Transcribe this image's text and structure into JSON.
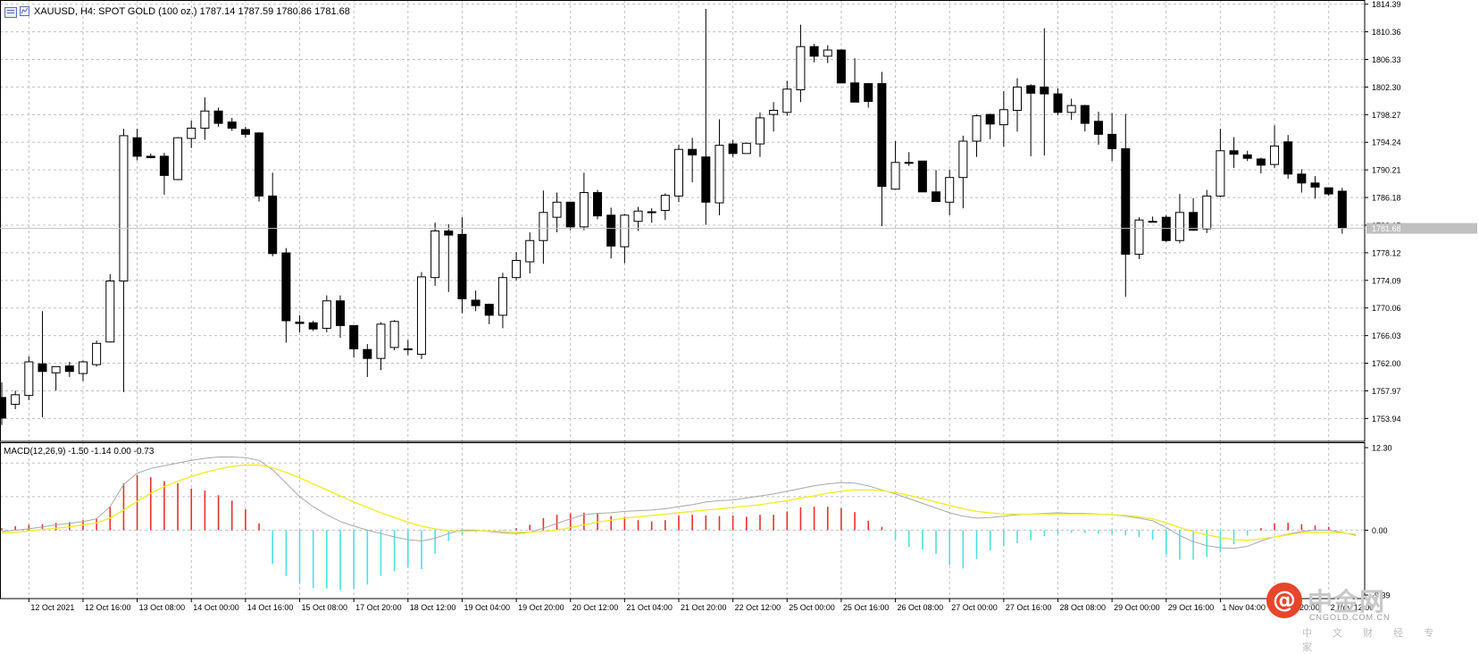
{
  "header": {
    "symbol_line": "XAUUSD, H4:  SPOT GOLD (100 oz.)  1787.14 1787.59 1780.86 1781.68",
    "macd_line": "MACD(12,26,9) -1.50 -1.14 0.00 -0.73"
  },
  "watermark": {
    "brand": "中金网",
    "site": "CNGOLD.COM.CN",
    "tagline": "中 文 财 经 专 家"
  },
  "colors": {
    "bull_body": "#ffffff",
    "bear_body": "#000000",
    "grid": "#c0c0c0",
    "macd_pos": "#e8312f",
    "macd_neg": "#4ee0e0",
    "macd_line": "#a8a8a8",
    "signal_line": "#f2ec2e",
    "current_price_bg": "#c0c0c0"
  },
  "chart_data": {
    "type": "candlestick",
    "price_axis": {
      "ylim": [
        1750.6,
        1815.0
      ],
      "ticks": [
        "1814.39",
        "1810.36",
        "1806.33",
        "1802.30",
        "1798.27",
        "1794.24",
        "1790.21",
        "1786.18",
        "1782.15",
        "1778.12",
        "1774.09",
        "1770.06",
        "1766.03",
        "1762.00",
        "1757.97",
        "1753.94"
      ],
      "tick_values": [
        1814.39,
        1810.36,
        1806.33,
        1802.3,
        1798.27,
        1794.24,
        1790.21,
        1786.18,
        1782.15,
        1778.12,
        1774.09,
        1770.06,
        1766.03,
        1762.0,
        1757.97,
        1753.94
      ],
      "current_price": 1781.68,
      "current_price_label": "1781.68"
    },
    "time_axis": {
      "labels": [
        "12 Oct 2021",
        "12 Oct 16:00",
        "13 Oct 08:00",
        "14 Oct 00:00",
        "14 Oct 16:00",
        "15 Oct 08:00",
        "17 Oct 20:00",
        "18 Oct 12:00",
        "19 Oct 04:00",
        "19 Oct 20:00",
        "20 Oct 12:00",
        "21 Oct 04:00",
        "21 Oct 20:00",
        "22 Oct 12:00",
        "25 Oct 00:00",
        "25 Oct 16:00",
        "26 Oct 08:00",
        "27 Oct 00:00",
        "27 Oct 16:00",
        "28 Oct 08:00",
        "29 Oct 00:00",
        "29 Oct 16:00",
        "1 Nov 04:00",
        "1 Nov 20:00",
        "2 Nov 12:00"
      ],
      "label_bar_index": [
        2,
        6,
        10,
        14,
        18,
        22,
        26,
        30,
        34,
        38,
        42,
        46,
        50,
        54,
        58,
        62,
        66,
        70,
        74,
        78,
        82,
        86,
        90,
        94,
        98
      ]
    },
    "ohlc": [
      [
        1757.0,
        1759.2,
        1753.0,
        1754.0
      ],
      [
        1756.0,
        1758.0,
        1755.3,
        1757.4
      ],
      [
        1757.3,
        1763.0,
        1756.6,
        1762.2
      ],
      [
        1761.9,
        1769.6,
        1754.1,
        1760.8
      ],
      [
        1760.6,
        1761.5,
        1758.0,
        1761.5
      ],
      [
        1761.6,
        1762.2,
        1760.0,
        1760.8
      ],
      [
        1760.5,
        1762.4,
        1759.4,
        1762.2
      ],
      [
        1761.8,
        1765.3,
        1761.5,
        1764.9
      ],
      [
        1765.1,
        1775.0,
        1765.0,
        1774.0
      ],
      [
        1774.0,
        1796.2,
        1757.8,
        1795.2
      ],
      [
        1794.9,
        1796.2,
        1791.6,
        1792.2
      ],
      [
        1792.2,
        1792.6,
        1791.9,
        1792.0
      ],
      [
        1792.2,
        1792.7,
        1786.6,
        1789.4
      ],
      [
        1788.8,
        1795.0,
        1788.7,
        1794.9
      ],
      [
        1794.8,
        1797.4,
        1793.4,
        1796.3
      ],
      [
        1796.3,
        1800.8,
        1794.6,
        1798.8
      ],
      [
        1798.8,
        1799.3,
        1796.5,
        1797.0
      ],
      [
        1797.2,
        1797.8,
        1795.9,
        1796.3
      ],
      [
        1796.1,
        1796.5,
        1794.9,
        1795.4
      ],
      [
        1795.6,
        1795.7,
        1785.6,
        1786.4
      ],
      [
        1786.4,
        1789.8,
        1777.6,
        1778.0
      ],
      [
        1778.1,
        1778.8,
        1765.0,
        1768.2
      ],
      [
        1768.0,
        1769.0,
        1766.5,
        1767.8
      ],
      [
        1767.9,
        1768.2,
        1766.7,
        1767.0
      ],
      [
        1767.1,
        1771.9,
        1766.5,
        1771.1
      ],
      [
        1771.1,
        1771.9,
        1765.7,
        1767.5
      ],
      [
        1767.5,
        1767.5,
        1762.8,
        1764.1
      ],
      [
        1764.0,
        1764.8,
        1760.0,
        1762.7
      ],
      [
        1762.7,
        1768.0,
        1761.0,
        1767.7
      ],
      [
        1764.3,
        1768.3,
        1763.9,
        1768.1
      ],
      [
        1764.0,
        1765.4,
        1763.2,
        1764.1
      ],
      [
        1763.3,
        1775.3,
        1762.6,
        1774.6
      ],
      [
        1774.5,
        1782.5,
        1773.3,
        1781.3
      ],
      [
        1781.3,
        1782.3,
        1772.4,
        1780.7
      ],
      [
        1780.8,
        1783.3,
        1769.3,
        1771.4
      ],
      [
        1771.2,
        1772.6,
        1769.6,
        1770.4
      ],
      [
        1770.6,
        1770.7,
        1767.7,
        1769.0
      ],
      [
        1769.0,
        1775.2,
        1767.1,
        1774.5
      ],
      [
        1774.5,
        1778.2,
        1774.1,
        1777.0
      ],
      [
        1776.8,
        1781.1,
        1775.1,
        1779.9
      ],
      [
        1779.9,
        1787.2,
        1776.5,
        1784.0
      ],
      [
        1783.3,
        1786.9,
        1781.1,
        1785.5
      ],
      [
        1785.5,
        1785.5,
        1781.4,
        1781.9
      ],
      [
        1781.9,
        1789.8,
        1781.4,
        1786.9
      ],
      [
        1786.9,
        1787.3,
        1783.0,
        1783.5
      ],
      [
        1783.6,
        1784.7,
        1777.3,
        1779.1
      ],
      [
        1779.0,
        1783.8,
        1776.6,
        1783.6
      ],
      [
        1782.7,
        1784.8,
        1781.3,
        1784.2
      ],
      [
        1784.1,
        1784.6,
        1782.5,
        1784.0
      ],
      [
        1784.3,
        1786.8,
        1782.9,
        1786.5
      ],
      [
        1786.4,
        1793.9,
        1785.5,
        1793.2
      ],
      [
        1793.2,
        1794.9,
        1788.4,
        1792.4
      ],
      [
        1792.1,
        1813.7,
        1782.2,
        1785.5
      ],
      [
        1785.4,
        1797.6,
        1783.6,
        1793.8
      ],
      [
        1794.0,
        1794.6,
        1792.1,
        1792.6
      ],
      [
        1792.6,
        1794.1,
        1792.6,
        1794.1
      ],
      [
        1794.0,
        1798.6,
        1792.1,
        1797.8
      ],
      [
        1798.3,
        1800.1,
        1795.8,
        1798.9
      ],
      [
        1798.6,
        1803.2,
        1798.1,
        1802.0
      ],
      [
        1801.9,
        1811.4,
        1800.1,
        1808.2
      ],
      [
        1808.2,
        1808.6,
        1805.9,
        1806.8
      ],
      [
        1806.8,
        1808.4,
        1805.8,
        1807.7
      ],
      [
        1807.7,
        1807.8,
        1802.9,
        1802.9
      ],
      [
        1802.9,
        1806.5,
        1800.6,
        1800.1
      ],
      [
        1802.8,
        1802.9,
        1799.3,
        1800.2
      ],
      [
        1802.8,
        1804.5,
        1782.0,
        1787.8
      ],
      [
        1787.4,
        1794.4,
        1787.3,
        1791.3
      ],
      [
        1791.3,
        1792.8,
        1790.8,
        1791.2
      ],
      [
        1791.5,
        1791.5,
        1787.3,
        1787.0
      ],
      [
        1787.0,
        1790.2,
        1786.2,
        1785.6
      ],
      [
        1785.5,
        1790.2,
        1783.6,
        1789.1
      ],
      [
        1789.1,
        1795.2,
        1784.6,
        1794.4
      ],
      [
        1794.4,
        1798.3,
        1792.1,
        1798.1
      ],
      [
        1798.3,
        1798.4,
        1794.7,
        1796.9
      ],
      [
        1796.8,
        1801.7,
        1793.6,
        1799.0
      ],
      [
        1798.9,
        1803.6,
        1795.8,
        1802.3
      ],
      [
        1802.5,
        1802.7,
        1792.2,
        1801.4
      ],
      [
        1802.3,
        1810.9,
        1792.3,
        1801.3
      ],
      [
        1801.3,
        1802.1,
        1798.2,
        1798.6
      ],
      [
        1798.6,
        1800.6,
        1797.5,
        1799.6
      ],
      [
        1799.6,
        1799.7,
        1795.8,
        1797.0
      ],
      [
        1797.3,
        1798.7,
        1793.9,
        1795.4
      ],
      [
        1795.4,
        1798.5,
        1791.5,
        1793.3
      ],
      [
        1793.3,
        1798.4,
        1771.7,
        1777.9
      ],
      [
        1777.9,
        1783.3,
        1777.2,
        1782.9
      ],
      [
        1782.7,
        1783.4,
        1782.6,
        1782.7
      ],
      [
        1783.3,
        1783.6,
        1779.7,
        1779.9
      ],
      [
        1779.9,
        1786.7,
        1779.5,
        1784.0
      ],
      [
        1784.0,
        1786.1,
        1781.4,
        1781.4
      ],
      [
        1781.6,
        1787.3,
        1781.0,
        1786.4
      ],
      [
        1786.4,
        1796.2,
        1786.2,
        1793.0
      ],
      [
        1793.0,
        1795.0,
        1790.5,
        1792.5
      ],
      [
        1792.4,
        1793.0,
        1791.5,
        1791.9
      ],
      [
        1791.8,
        1792.0,
        1789.7,
        1790.9
      ],
      [
        1791.0,
        1796.7,
        1790.5,
        1793.7
      ],
      [
        1794.3,
        1795.3,
        1788.9,
        1789.6
      ],
      [
        1789.6,
        1790.3,
        1786.9,
        1788.3
      ],
      [
        1788.3,
        1789.3,
        1786.0,
        1787.7
      ],
      [
        1787.6,
        1787.6,
        1786.4,
        1786.7
      ],
      [
        1787.1,
        1787.6,
        1780.9,
        1781.7
      ]
    ],
    "macd": {
      "ylim": [
        -9.39,
        12.3
      ],
      "ticks": [
        "12.30",
        "0.00",
        "-9.39"
      ],
      "tick_values": [
        12.3,
        0.0,
        -9.39
      ],
      "histogram": [
        0.3,
        0.6,
        0.8,
        0.9,
        1.1,
        1.2,
        1.5,
        1.8,
        3.5,
        7.0,
        8.2,
        7.9,
        7.3,
        7.0,
        6.2,
        5.9,
        5.2,
        4.4,
        3.1,
        1.0,
        -5.0,
        -6.8,
        -7.9,
        -8.6,
        -8.7,
        -8.9,
        -8.7,
        -8.1,
        -6.8,
        -6.1,
        -5.5,
        -5.8,
        -3.5,
        -1.6,
        -0.6,
        -0.3,
        -0.2,
        -0.1,
        0.3,
        0.8,
        1.8,
        2.3,
        2.5,
        2.6,
        2.5,
        2.1,
        2.0,
        1.5,
        1.3,
        1.5,
        2.2,
        2.3,
        2.2,
        2.1,
        2.2,
        2.0,
        2.3,
        2.3,
        2.8,
        3.4,
        3.5,
        3.5,
        3.3,
        2.7,
        1.4,
        0.5,
        -1.4,
        -2.5,
        -2.9,
        -3.5,
        -5.2,
        -5.7,
        -4.3,
        -3.0,
        -2.3,
        -1.9,
        -1.5,
        -0.9,
        -0.6,
        -0.4,
        -0.4,
        -0.5,
        -0.6,
        -0.8,
        -1.0,
        -1.4,
        -3.6,
        -4.4,
        -4.4,
        -4.0,
        -3.3,
        -2.1,
        -0.8,
        0.3,
        1.0,
        1.1,
        0.9,
        0.7,
        0.5,
        0.0
      ],
      "macd_line": [
        -0.2,
        0.0,
        0.2,
        0.5,
        0.8,
        1.0,
        1.3,
        1.7,
        3.5,
        6.8,
        8.5,
        9.2,
        9.6,
        10.0,
        10.4,
        10.7,
        10.9,
        10.9,
        10.8,
        10.4,
        9.0,
        7.0,
        5.0,
        3.5,
        2.3,
        1.3,
        0.6,
        0.0,
        -0.5,
        -1.0,
        -1.4,
        -1.6,
        -1.2,
        -0.5,
        0.0,
        0.0,
        -0.2,
        -0.4,
        -0.5,
        -0.3,
        0.3,
        1.0,
        1.7,
        2.3,
        2.5,
        2.6,
        2.8,
        2.9,
        3.0,
        3.2,
        3.5,
        3.8,
        4.2,
        4.4,
        4.5,
        4.8,
        5.1,
        5.4,
        5.8,
        6.2,
        6.6,
        6.9,
        7.1,
        7.0,
        6.6,
        6.0,
        5.4,
        4.7,
        4.0,
        3.3,
        2.6,
        2.1,
        1.8,
        1.9,
        2.1,
        2.3,
        2.4,
        2.5,
        2.6,
        2.5,
        2.5,
        2.4,
        2.3,
        2.1,
        1.8,
        1.4,
        0.4,
        -0.8,
        -1.7,
        -2.3,
        -2.6,
        -2.7,
        -2.4,
        -1.6,
        -1.0,
        -0.6,
        -0.2,
        0.0,
        0.0,
        -0.3,
        -0.8
      ],
      "signal_line": [
        -0.4,
        -0.3,
        -0.1,
        0.1,
        0.3,
        0.5,
        0.8,
        1.1,
        1.8,
        3.0,
        4.3,
        5.5,
        6.5,
        7.3,
        8.0,
        8.6,
        9.1,
        9.5,
        9.7,
        9.7,
        9.3,
        8.6,
        7.8,
        6.9,
        6.0,
        5.1,
        4.2,
        3.4,
        2.6,
        1.9,
        1.2,
        0.6,
        0.2,
        -0.1,
        -0.2,
        -0.1,
        -0.1,
        -0.2,
        -0.3,
        -0.3,
        -0.2,
        0.0,
        0.4,
        0.8,
        1.2,
        1.5,
        1.8,
        2.0,
        2.2,
        2.4,
        2.6,
        2.8,
        3.0,
        3.2,
        3.4,
        3.6,
        3.8,
        4.1,
        4.4,
        4.8,
        5.1,
        5.5,
        5.8,
        6.0,
        6.0,
        5.9,
        5.6,
        5.2,
        4.7,
        4.2,
        3.7,
        3.2,
        2.8,
        2.6,
        2.4,
        2.4,
        2.4,
        2.4,
        2.4,
        2.4,
        2.4,
        2.4,
        2.3,
        2.2,
        2.0,
        1.7,
        1.1,
        0.4,
        -0.2,
        -0.7,
        -1.1,
        -1.4,
        -1.5,
        -1.3,
        -1.0,
        -0.7,
        -0.4,
        -0.3,
        -0.3,
        -0.4,
        -0.6
      ]
    }
  }
}
